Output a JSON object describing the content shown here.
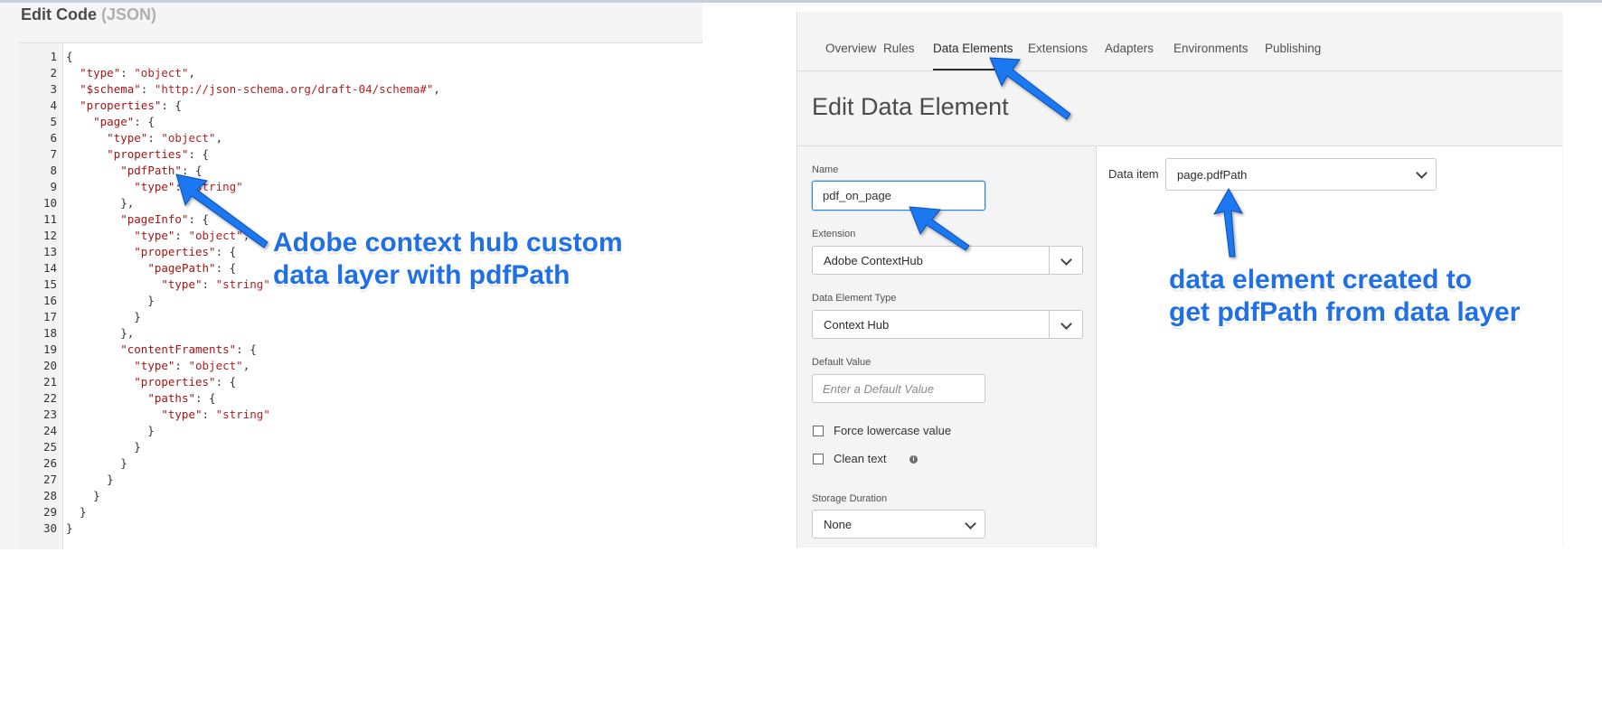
{
  "code_editor": {
    "title": "Edit Code",
    "subtitle": "(JSON)",
    "lines": [
      "{",
      "  \"type\": \"object\",",
      "  \"$schema\": \"http://json-schema.org/draft-04/schema#\",",
      "  \"properties\": {",
      "    \"page\": {",
      "      \"type\": \"object\",",
      "      \"properties\": {",
      "        \"pdfPath\": {",
      "          \"type\": \"string\"",
      "        },",
      "        \"pageInfo\": {",
      "          \"type\": \"object\",",
      "          \"properties\": {",
      "            \"pagePath\": {",
      "              \"type\": \"string\"",
      "            }",
      "          }",
      "        },",
      "        \"contentFraments\": {",
      "          \"type\": \"object\",",
      "          \"properties\": {",
      "            \"paths\": {",
      "              \"type\": \"string\"",
      "            }",
      "          }",
      "        }",
      "      }",
      "    }",
      "  }",
      "}"
    ]
  },
  "tabs": [
    "Overview",
    "Rules",
    "Data Elements",
    "Extensions",
    "Adapters",
    "Environments",
    "Publishing"
  ],
  "active_tab": "Data Elements",
  "form": {
    "page_title": "Edit Data Element",
    "name_label": "Name",
    "name_value": "pdf_on_page",
    "extension_label": "Extension",
    "extension_value": "Adobe ContextHub",
    "type_label": "Data Element Type",
    "type_value": "Context Hub",
    "default_label": "Default Value",
    "default_placeholder": "Enter a Default Value",
    "force_lowercase_label": "Force lowercase value",
    "clean_text_label": "Clean text",
    "storage_label": "Storage Duration",
    "storage_value": "None",
    "data_item_label": "Data item",
    "data_item_value": "page.pdfPath"
  },
  "annotations": {
    "left_line1": "Adobe context hub custom",
    "left_line2": "data layer with pdfPath",
    "right_line1": "data element created to",
    "right_line2": "get pdfPath from data layer",
    "color": "#1f6fe6"
  },
  "icons": [
    "chevron-down-icon",
    "info-icon",
    "arrow-icon"
  ]
}
